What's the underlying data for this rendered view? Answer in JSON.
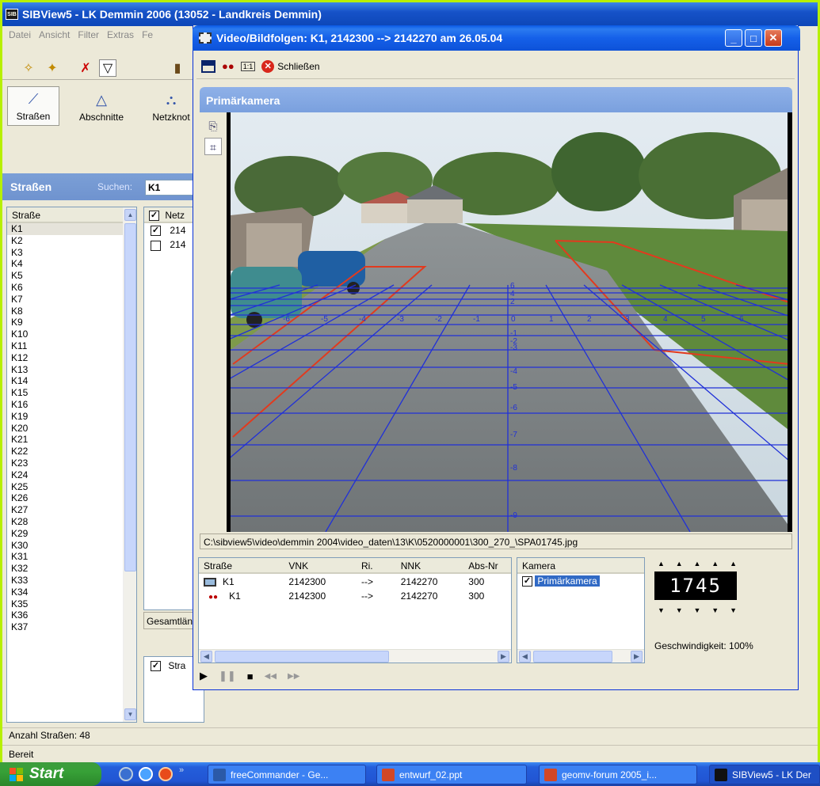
{
  "main": {
    "title": "SIBView5 - LK Demmin 2006 (13052 - Landkreis Demmin)",
    "icon_text": "SIB",
    "menu": [
      "Datei",
      "Ansicht",
      "Filter",
      "Extras",
      "Fe"
    ],
    "big_buttons": [
      "Straßen",
      "Abschnitte",
      "Netzknot"
    ],
    "strassen_label": "Straßen",
    "search_label": "Suchen:",
    "search_value": "K1",
    "list_header": "Straße",
    "list_items": [
      "K1",
      "K2",
      "K3",
      "K4",
      "K5",
      "K6",
      "K7",
      "K8",
      "K9",
      "K10",
      "K11",
      "K12",
      "K13",
      "K14",
      "K15",
      "K16",
      "K19",
      "K20",
      "K21",
      "K22",
      "K23",
      "K24",
      "K25",
      "K26",
      "K27",
      "K28",
      "K29",
      "K30",
      "K31",
      "K32",
      "K33",
      "K34",
      "K35",
      "K36",
      "K37"
    ],
    "mid_header": "Netz",
    "mid_rows": [
      "214",
      "214"
    ],
    "mid_bottom": "Gesamtlän",
    "mid_bottom2": "Stra",
    "count_label": "Anzahl Straßen: 48",
    "status": "Bereit"
  },
  "video": {
    "title": "Video/Bildfolgen: K1, 2142300 --> 2142270 am 26.05.04",
    "close_label": "Schließen",
    "panel_title": "Primärkamera",
    "path": "C:\\sibview5\\video\\demmin 2004\\video_daten\\13\\K\\0520000001\\300_270_\\SPA01745.jpg",
    "columns": [
      "Straße",
      "VNK",
      "Ri.",
      "NNK",
      "Abs-Nr"
    ],
    "rows": [
      [
        "K1",
        "2142300",
        "-->",
        "2142270",
        "300"
      ],
      [
        "K1",
        "2142300",
        "-->",
        "2142270",
        "300"
      ]
    ],
    "cam_header": "Kamera",
    "cam_item": "Primärkamera",
    "frame": "1745",
    "speed": "Geschwindigkeit: 100%",
    "grid_labels_x": [
      "-6",
      "-5",
      "-4",
      "-3",
      "-2",
      "-1",
      "0",
      "1",
      "2",
      "3",
      "4",
      "5",
      "6"
    ],
    "grid_labels_y": [
      "6",
      "4",
      "2",
      "-1",
      "-2",
      "-3",
      "-4",
      "-5",
      "-6",
      "-7",
      "-8",
      "-9"
    ]
  },
  "taskbar": {
    "start": "Start",
    "tasks": [
      "freeCommander - Ge...",
      "entwurf_02.ppt",
      "geomv-forum 2005_i...",
      "SIBView5 - LK Der"
    ]
  }
}
